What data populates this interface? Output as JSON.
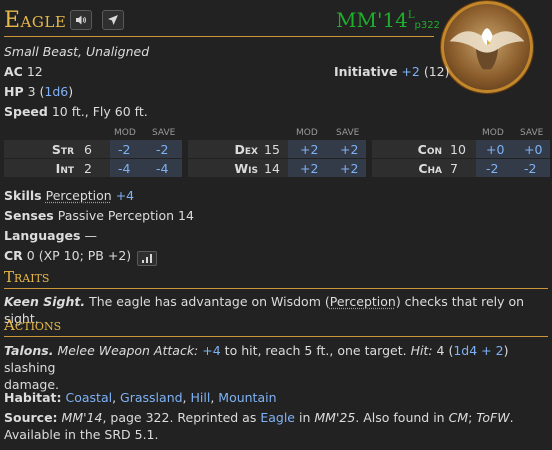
{
  "title": "Eagle",
  "source": {
    "abbr": "MM'14",
    "sup": "L",
    "page": "p322"
  },
  "icons": {
    "speak": "speaker-icon",
    "hover": "hover-pointer-icon"
  },
  "meta": "Small Beast, Unaligned",
  "ac": {
    "label": "AC",
    "value": "12"
  },
  "initiative": {
    "label": "Initiative",
    "mod": "+2",
    "score": "(12)"
  },
  "hp": {
    "label": "HP",
    "value": "3",
    "formula": "1d6"
  },
  "speed": {
    "label": "Speed",
    "value": "10 ft., Fly 60 ft."
  },
  "ability_headers": {
    "mod": "MOD",
    "save": "SAVE"
  },
  "abilities": [
    {
      "name": "Str",
      "score": "6",
      "mod": "-2",
      "save": "-2"
    },
    {
      "name": "Int",
      "score": "2",
      "mod": "-4",
      "save": "-4"
    },
    {
      "name": "Dex",
      "score": "15",
      "mod": "+2",
      "save": "+2"
    },
    {
      "name": "Wis",
      "score": "14",
      "mod": "+2",
      "save": "+2"
    },
    {
      "name": "Con",
      "score": "10",
      "mod": "+0",
      "save": "+0"
    },
    {
      "name": "Cha",
      "score": "7",
      "mod": "-2",
      "save": "-2"
    }
  ],
  "skills": {
    "label": "Skills",
    "skill": "Perception",
    "mod": "+4"
  },
  "senses": {
    "label": "Senses",
    "value": "Passive Perception 14"
  },
  "languages": {
    "label": "Languages",
    "value": "—"
  },
  "cr": {
    "label": "CR",
    "value": "0 (XP 10; PB +2)"
  },
  "traits": {
    "heading": "Traits",
    "items": [
      {
        "name": "Keen Sight.",
        "pre": "The eagle has advantage on Wisdom (",
        "link": "Perception",
        "post": ") checks that rely on sight."
      }
    ]
  },
  "actions": {
    "heading": "Actions",
    "items": [
      {
        "name": "Talons.",
        "type": "Melee Weapon Attack:",
        "hit_mod": "+4",
        "mid": "to hit, reach 5 ft., one target.",
        "hit_label": "Hit:",
        "dmg": "4",
        "dmg_formula": "1d4 + 2",
        "tail": "slashing",
        "line2": "damage."
      }
    ]
  },
  "habitat": {
    "label": "Habitat:",
    "items": [
      "Coastal",
      "Grassland",
      "Hill",
      "Mountain"
    ]
  },
  "source_line": {
    "label": "Source:",
    "book": "MM'14",
    "page_text": ", page 322. Reprinted as",
    "reprint": "Eagle",
    "in_text": "in",
    "book2": "MM'25",
    "also": ". Also found in",
    "book3": "CM",
    "book4": "ToFW",
    "srd": "Available in the SRD 5.1."
  }
}
